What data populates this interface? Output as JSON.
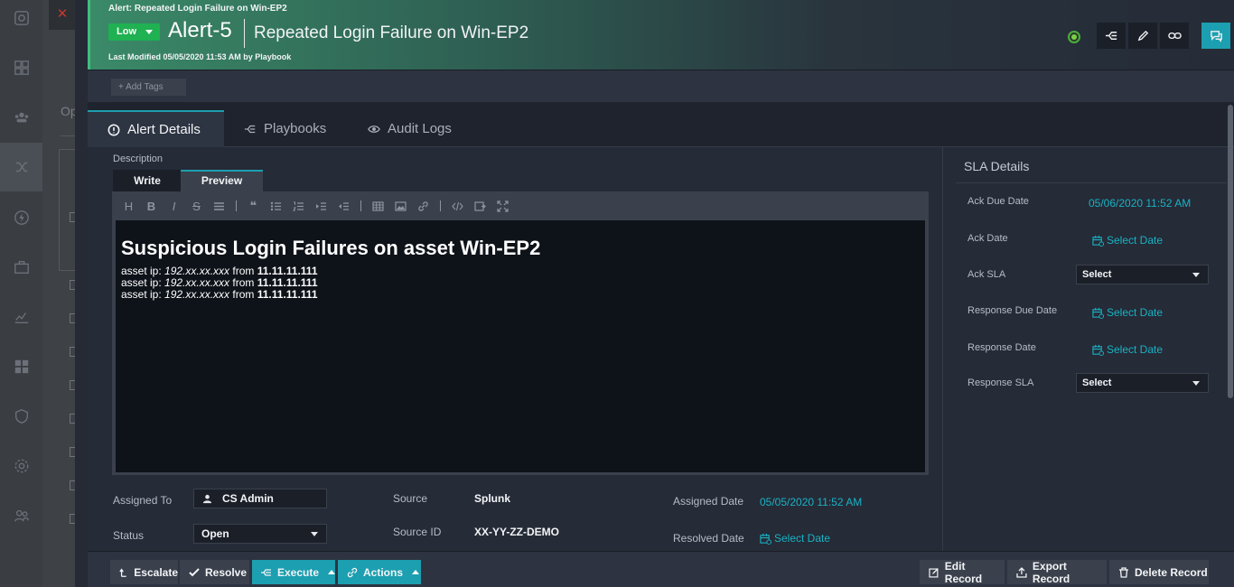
{
  "background": {
    "close_icon": "✕",
    "column_text": "Op"
  },
  "header": {
    "breadcrumb": "Alert: Repeated Login Failure on Win-EP2",
    "severity": "Low",
    "alert_id": "Alert-5",
    "title": "Repeated Login Failure on Win-EP2",
    "last_modified": "Last Modified 05/05/2020 11:53 AM by Playbook",
    "accent_color": "#3fbf7f",
    "severity_color": "#1fb152"
  },
  "tags": {
    "add_label": "+ Add Tags"
  },
  "tabs": [
    {
      "label": "Alert Details",
      "icon": "alert-circle-icon"
    },
    {
      "label": "Playbooks",
      "icon": "playbook-icon"
    },
    {
      "label": "Audit Logs",
      "icon": "eye-icon"
    }
  ],
  "description": {
    "label": "Description",
    "write_tab": "Write",
    "preview_tab": "Preview",
    "heading": "Suspicious Login Failures on asset Win-EP2",
    "lines": [
      {
        "prefix": "asset ip: ",
        "ip": "192.xx.xx.xxx",
        "mid": " from ",
        "src": "11.11.11.111"
      },
      {
        "prefix": "asset ip: ",
        "ip": "192.xx.xx.xxx",
        "mid": " from ",
        "src": "11.11.11.111"
      },
      {
        "prefix": "asset ip: ",
        "ip": "192.xx.xx.xxx",
        "mid": " from ",
        "src": "11.11.11.111"
      }
    ]
  },
  "fields": {
    "assigned_to_label": "Assigned To",
    "assigned_to": "CS Admin",
    "status_label": "Status",
    "status": "Open",
    "source_label": "Source",
    "source": "Splunk",
    "source_id_label": "Source ID",
    "source_id": "XX-YY-ZZ-DEMO",
    "assigned_date_label": "Assigned Date",
    "assigned_date": "05/05/2020 11:52 AM",
    "resolved_date_label": "Resolved Date",
    "resolved_date": "Select Date"
  },
  "sla": {
    "title": "SLA Details",
    "ack_due_label": "Ack Due Date",
    "ack_due": "05/06/2020 11:52 AM",
    "ack_date_label": "Ack Date",
    "ack_date": "Select Date",
    "ack_sla_label": "Ack SLA",
    "ack_sla": "Select",
    "resp_due_label": "Response Due Date",
    "resp_due": "Select Date",
    "resp_date_label": "Response Date",
    "resp_date": "Select Date",
    "resp_sla_label": "Response SLA",
    "resp_sla": "Select"
  },
  "footer": {
    "escalate": "Escalate",
    "resolve": "Resolve",
    "execute": "Execute",
    "actions": "Actions",
    "edit_record": "Edit Record",
    "export_record": "Export Record",
    "delete_record": "Delete Record"
  },
  "colors": {
    "teal": "#1c9fb0",
    "link": "#1ab2c4"
  }
}
